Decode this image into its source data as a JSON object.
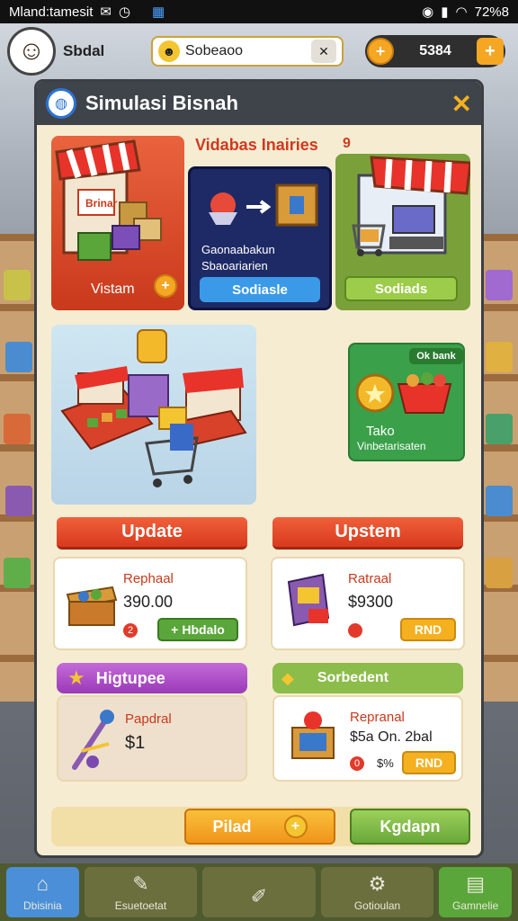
{
  "status": {
    "carrier": "Mland:tamesit",
    "time": "72%8"
  },
  "header": {
    "player_name": "Sbdal",
    "search_value": "Sobeaoo",
    "coins": "5384"
  },
  "panel": {
    "title": "Simulasi Bisnah",
    "section_title": "Vidabas Inairies",
    "section_badge": "9",
    "card1": {
      "sign": "Brinar",
      "label": "Vistam"
    },
    "card2": {
      "text1": "Gaonaabakun",
      "text2": "Sbaoariarien",
      "button": "Sodiasle"
    },
    "card3": {
      "button": "Sodiads"
    },
    "card4": {
      "badge": "Ok bank",
      "title": "Tako",
      "subtitle": "Vinbetarisaten"
    },
    "update_bar": "Update",
    "upstem_bar": "Upstem",
    "item1": {
      "name": "Rephaal",
      "price": "390.00",
      "badge": "2",
      "button": "Hbdalo"
    },
    "item2": {
      "name": "Ratraal",
      "price": "$9300",
      "button": "RND"
    },
    "bar3": "Higtupee",
    "bar4": "Sorbedent",
    "item3": {
      "name": "Papdral",
      "price": "$1"
    },
    "item4": {
      "name": "Repranal",
      "price": "$5a On. 2bal",
      "badge": "0",
      "percent": "$%",
      "button": "RND"
    },
    "footer": {
      "pilot_label": "Pilad",
      "confirm_label": "Kgdapn"
    }
  },
  "nav": [
    {
      "label": "Dbisinia",
      "icon": "home-icon"
    },
    {
      "label": "Esuetoetat",
      "icon": "pencil-icon"
    },
    {
      "label": "",
      "icon": "edit-icon"
    },
    {
      "label": "Gotioulan",
      "icon": "gear-icon"
    },
    {
      "label": "Gamnelie",
      "icon": "store-icon"
    }
  ]
}
